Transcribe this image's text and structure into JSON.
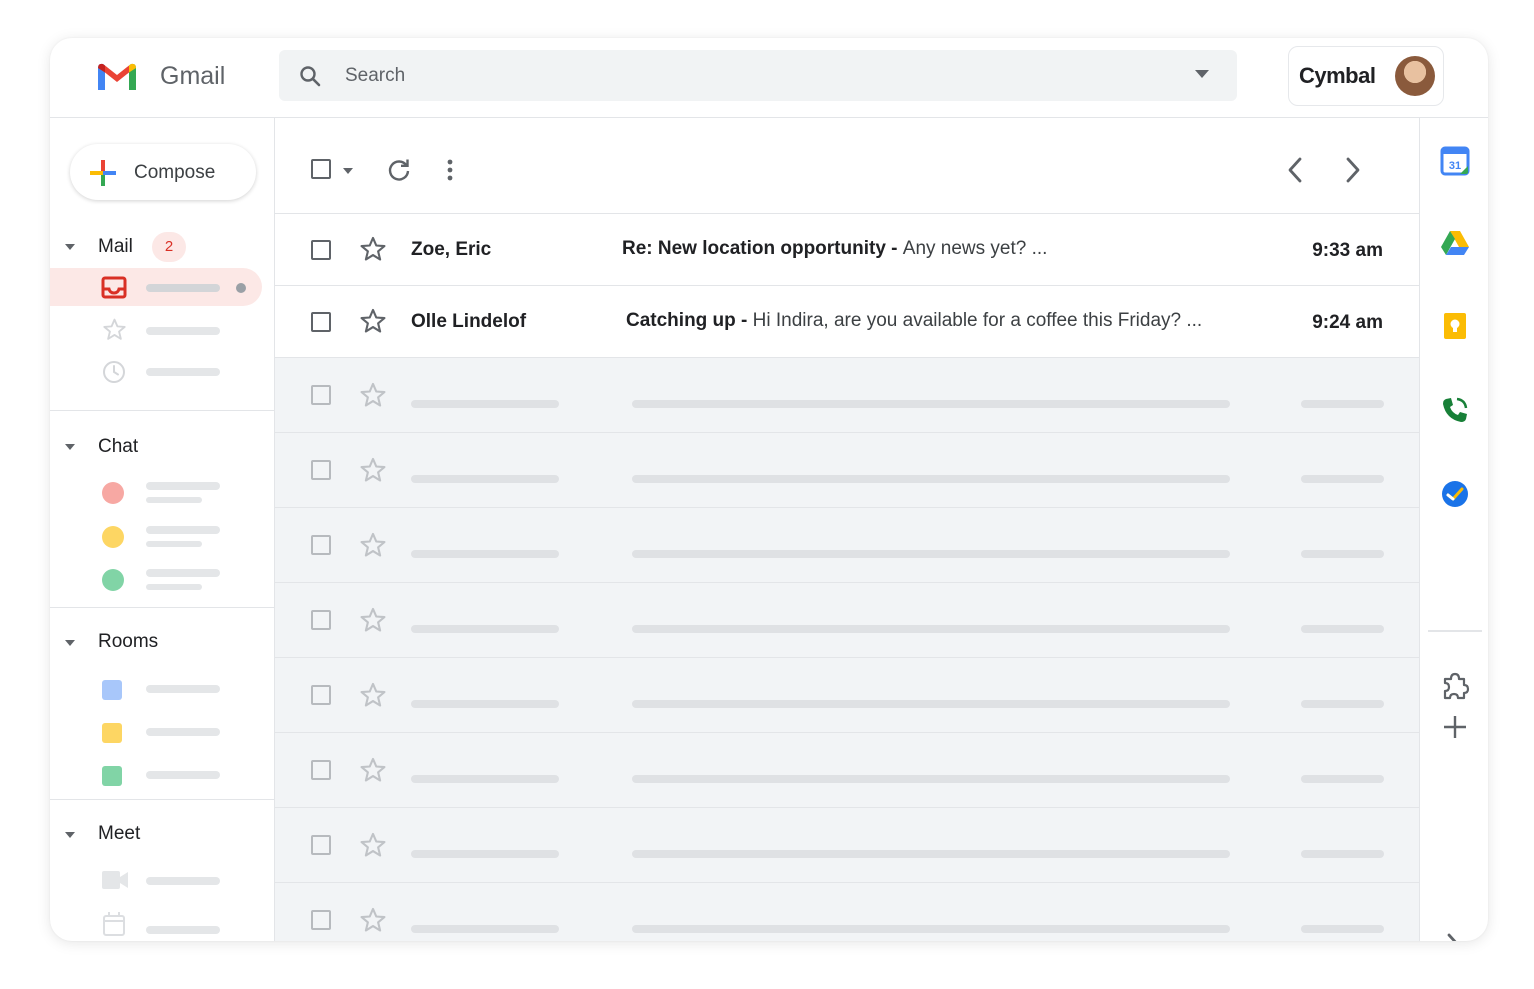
{
  "app": {
    "brand": "Gmail",
    "account_label": "Cymbal"
  },
  "search": {
    "placeholder": "Search"
  },
  "compose": {
    "label": "Compose"
  },
  "nav": {
    "mail": {
      "title": "Mail",
      "badge": "2"
    },
    "chat": {
      "title": "Chat"
    },
    "rooms": {
      "title": "Rooms"
    },
    "meet": {
      "title": "Meet"
    }
  },
  "messages": [
    {
      "sender": "Zoe, Eric",
      "subject": "Re: New location opportunity",
      "separator": " - ",
      "snippet": "Any news yet? ...",
      "time": "9:33 am"
    },
    {
      "sender": "Olle Lindelof",
      "subject": "Catching up",
      "separator": " - ",
      "snippet": "Hi Indira, are you available for a coffee this Friday? ...",
      "time": "9:24 am"
    }
  ],
  "colors": {
    "accent_red": "#ea4335",
    "badge_bg": "#fce8e6",
    "chat_dots": [
      "#f7a8a3",
      "#fdd663",
      "#81d4a6"
    ],
    "room_squares": [
      "#a8c7fa",
      "#fdd663",
      "#81d4a6"
    ]
  },
  "icons": {
    "search": "search-icon",
    "refresh": "refresh-icon",
    "more": "more-vert-icon",
    "prev": "chevron-left-icon",
    "next": "chevron-right-icon",
    "rail": [
      "calendar-icon",
      "drive-icon",
      "keep-icon",
      "voice-icon",
      "tasks-icon",
      "addons-icon",
      "add-icon",
      "expand-icon"
    ]
  }
}
